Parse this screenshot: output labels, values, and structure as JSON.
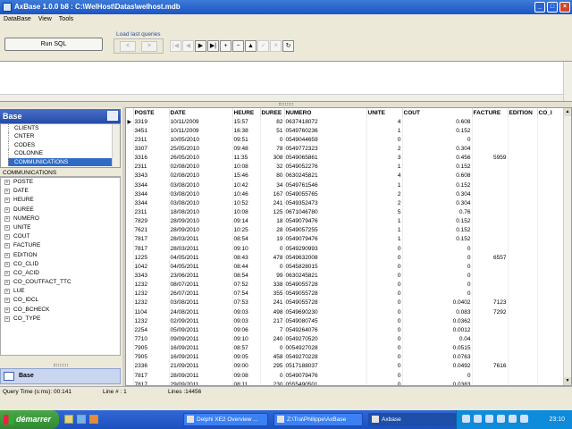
{
  "window": {
    "title": "AxBase 1.0.0  b8 : C:\\WelHost\\Datas\\welhost.mdb"
  },
  "menu": [
    "DataBase",
    "View",
    "Tools"
  ],
  "toolbar": {
    "run_sql": "Run SQL",
    "load_last_queries": "Load last queries",
    "prev": "<",
    "next": ">",
    "nav_buttons": [
      "|◀",
      "◀",
      "▶",
      "▶|",
      "+",
      "−",
      "▲",
      "✓",
      "✕",
      "↻"
    ]
  },
  "left": {
    "header": "Base",
    "tables": [
      "CLIENTS",
      "CNTER",
      "CODES",
      "COLONNE",
      "COMMUNICATIONS"
    ],
    "selected_table": "COMMUNICATIONS",
    "field_header": "COMMUNICATIONS",
    "fields": [
      "POSTE",
      "DATE",
      "HEURE",
      "DUREE",
      "NUMERO",
      "UNITE",
      "COUT",
      "FACTURE",
      "EDITION",
      "CO_CLID",
      "CO_ACID",
      "CO_COUTFACT_TTC",
      "LUE",
      "CO_IDCL",
      "CO_BCHECK",
      "CO_TYPE"
    ],
    "base_button": "Base"
  },
  "grid": {
    "columns": [
      "POSTE",
      "DATE",
      "HEURE",
      "DUREE",
      "NUMERO",
      "UNITE",
      "COUT",
      "FACTURE",
      "EDITION",
      "CO_I"
    ],
    "rows": [
      [
        "3319",
        "10/11/2009",
        "15:57",
        "82",
        "0637418072",
        "4",
        "0.608",
        "",
        ""
      ],
      [
        "3451",
        "10/11/2009",
        "16:38",
        "51",
        "0549760236",
        "1",
        "0.152",
        "",
        ""
      ],
      [
        "2311",
        "10/05/2010",
        "09:51",
        "0",
        "0549044659",
        "0",
        "0",
        "",
        ""
      ],
      [
        "3307",
        "25/05/2010",
        "09:48",
        "78",
        "0549772323",
        "2",
        "0.304",
        "",
        ""
      ],
      [
        "3316",
        "26/05/2010",
        "11:35",
        "308",
        "0549065861",
        "3",
        "0.456",
        "5959",
        ""
      ],
      [
        "2311",
        "02/08/2010",
        "10:08",
        "32",
        "0549052276",
        "1",
        "0.152",
        "",
        ""
      ],
      [
        "3343",
        "02/08/2010",
        "15:46",
        "80",
        "0630245821",
        "4",
        "0.608",
        "",
        ""
      ],
      [
        "3344",
        "03/08/2010",
        "10:42",
        "34",
        "0549761546",
        "1",
        "0.152",
        "",
        ""
      ],
      [
        "3344",
        "03/08/2010",
        "10:46",
        "167",
        "0549055765",
        "2",
        "0.304",
        "",
        ""
      ],
      [
        "3344",
        "03/08/2010",
        "10:52",
        "241",
        "0549352473",
        "2",
        "0.304",
        "",
        ""
      ],
      [
        "2311",
        "18/08/2010",
        "10:08",
        "125",
        "0671046780",
        "5",
        "0.76",
        "",
        ""
      ],
      [
        "7829",
        "28/09/2010",
        "09:14",
        "18",
        "0549079476",
        "1",
        "0.152",
        "",
        ""
      ],
      [
        "7621",
        "28/09/2010",
        "10:25",
        "28",
        "0549057255",
        "1",
        "0.152",
        "",
        ""
      ],
      [
        "7817",
        "28/03/2011",
        "08:54",
        "19",
        "0549079476",
        "1",
        "0.152",
        "",
        ""
      ],
      [
        "7817",
        "28/03/2011",
        "09:10",
        "0",
        "0549290993",
        "0",
        "0",
        "",
        ""
      ],
      [
        "1225",
        "04/05/2011",
        "08:43",
        "478",
        "0549632008",
        "0",
        "0",
        "6557",
        ""
      ],
      [
        "1042",
        "04/05/2011",
        "08:44",
        "0",
        "0545828015",
        "0",
        "0",
        "",
        ""
      ],
      [
        "3343",
        "23/06/2011",
        "08:54",
        "99",
        "0630245821",
        "0",
        "0",
        "",
        ""
      ],
      [
        "1232",
        "08/07/2011",
        "07:52",
        "338",
        "0549055728",
        "0",
        "0",
        "",
        ""
      ],
      [
        "1232",
        "26/07/2011",
        "07:54",
        "355",
        "0549055728",
        "0",
        "0",
        "",
        ""
      ],
      [
        "1232",
        "03/08/2011",
        "07:53",
        "241",
        "0549055728",
        "0",
        "0.0402",
        "7123",
        ""
      ],
      [
        "1104",
        "24/08/2011",
        "09:03",
        "498",
        "0549690230",
        "0",
        "0.083",
        "7292",
        ""
      ],
      [
        "1232",
        "02/09/2011",
        "09:03",
        "217",
        "0549080745",
        "0",
        "0.0362",
        "",
        ""
      ],
      [
        "2254",
        "05/09/2011",
        "09:06",
        "7",
        "0549264076",
        "0",
        "0.0012",
        "",
        ""
      ],
      [
        "7710",
        "09/09/2011",
        "09:10",
        "240",
        "0549270520",
        "0",
        "0.04",
        "",
        ""
      ],
      [
        "7905",
        "16/09/2011",
        "08:57",
        "0",
        "0054927028",
        "0",
        "0.0515",
        "",
        ""
      ],
      [
        "7905",
        "16/09/2011",
        "09:05",
        "458",
        "0549270228",
        "0",
        "0.0763",
        "",
        ""
      ],
      [
        "2336",
        "21/09/2011",
        "09:00",
        "295",
        "0517188037",
        "0",
        "0.0492",
        "7616",
        ""
      ],
      [
        "7817",
        "28/09/2011",
        "09:08",
        "0",
        "0549079476",
        "0",
        "0",
        "",
        ""
      ],
      [
        "7817",
        "29/09/2011",
        "08:11",
        "230",
        "0555490501",
        "0",
        "0.0383",
        "",
        ""
      ]
    ]
  },
  "status": {
    "query_time": "Query Time (s:ms): 00:141",
    "line": "Line # : 1",
    "lines": "Lines :14456"
  },
  "taskbar": {
    "start": "démarrer",
    "tasks": [
      "Delphi XE2 Overview ...",
      "Z:\\Tra\\Philippe\\AxBase",
      "Axbase"
    ],
    "clock": "23:10"
  }
}
